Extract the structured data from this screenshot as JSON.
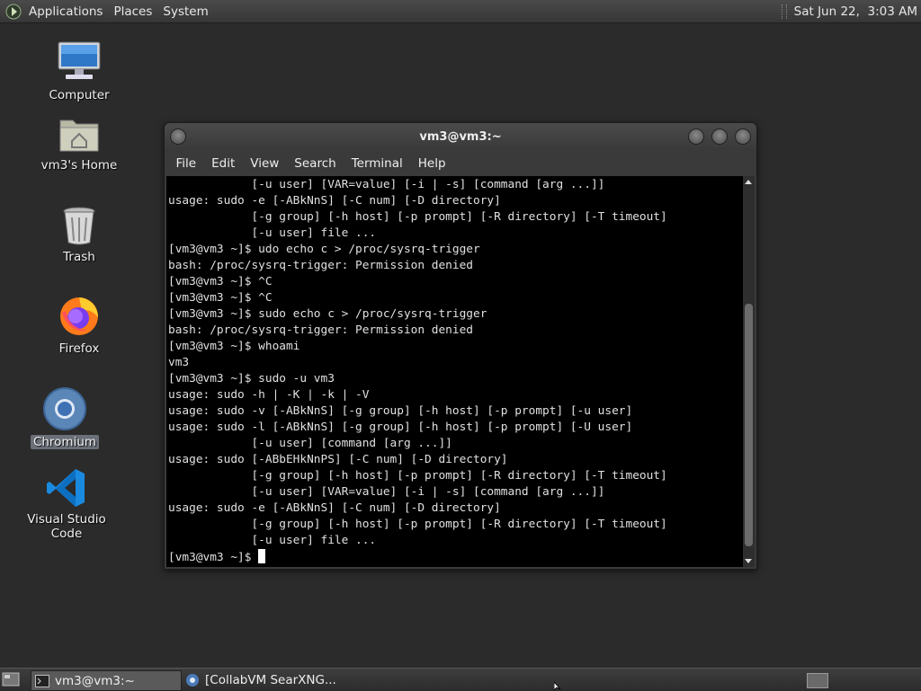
{
  "top_panel": {
    "menus": [
      "Applications",
      "Places",
      "System"
    ],
    "clock": "Sat Jun 22,  3:03 AM"
  },
  "desktop_icons": [
    {
      "label": "Computer",
      "icon": "computer-icon"
    },
    {
      "label": "vm3's Home",
      "icon": "home-folder-icon"
    },
    {
      "label": "Trash",
      "icon": "trash-icon"
    },
    {
      "label": "Firefox",
      "icon": "firefox-icon"
    },
    {
      "label": "Chromium",
      "icon": "chromium-icon",
      "selected": true
    },
    {
      "label": "Visual Studio Code",
      "icon": "vscode-icon"
    }
  ],
  "terminal": {
    "title": "vm3@vm3:~",
    "menu": [
      "File",
      "Edit",
      "View",
      "Search",
      "Terminal",
      "Help"
    ],
    "lines": [
      "            [-u user] [VAR=value] [-i | -s] [command [arg ...]]",
      "usage: sudo -e [-ABkNnS] [-C num] [-D directory]",
      "            [-g group] [-h host] [-p prompt] [-R directory] [-T timeout]",
      "            [-u user] file ...",
      "[vm3@vm3 ~]$ udo echo c > /proc/sysrq-trigger",
      "bash: /proc/sysrq-trigger: Permission denied",
      "[vm3@vm3 ~]$ ^C",
      "[vm3@vm3 ~]$ ^C",
      "[vm3@vm3 ~]$ sudo echo c > /proc/sysrq-trigger",
      "bash: /proc/sysrq-trigger: Permission denied",
      "[vm3@vm3 ~]$ whoami",
      "vm3",
      "[vm3@vm3 ~]$ sudo -u vm3",
      "usage: sudo -h | -K | -k | -V",
      "usage: sudo -v [-ABkNnS] [-g group] [-h host] [-p prompt] [-u user]",
      "usage: sudo -l [-ABkNnS] [-g group] [-h host] [-p prompt] [-U user]",
      "            [-u user] [command [arg ...]]",
      "usage: sudo [-ABbEHkNnPS] [-C num] [-D directory]",
      "            [-g group] [-h host] [-p prompt] [-R directory] [-T timeout]",
      "            [-u user] [VAR=value] [-i | -s] [command [arg ...]]",
      "usage: sudo -e [-ABkNnS] [-C num] [-D directory]",
      "            [-g group] [-h host] [-p prompt] [-R directory] [-T timeout]",
      "            [-u user] file ..."
    ],
    "prompt": "[vm3@vm3 ~]$ "
  },
  "taskbar": {
    "items": [
      {
        "label": "vm3@vm3:~",
        "icon": "terminal-icon",
        "active": true
      },
      {
        "label": "[CollabVM SearXNG...",
        "icon": "browser-icon",
        "active": false
      }
    ]
  }
}
